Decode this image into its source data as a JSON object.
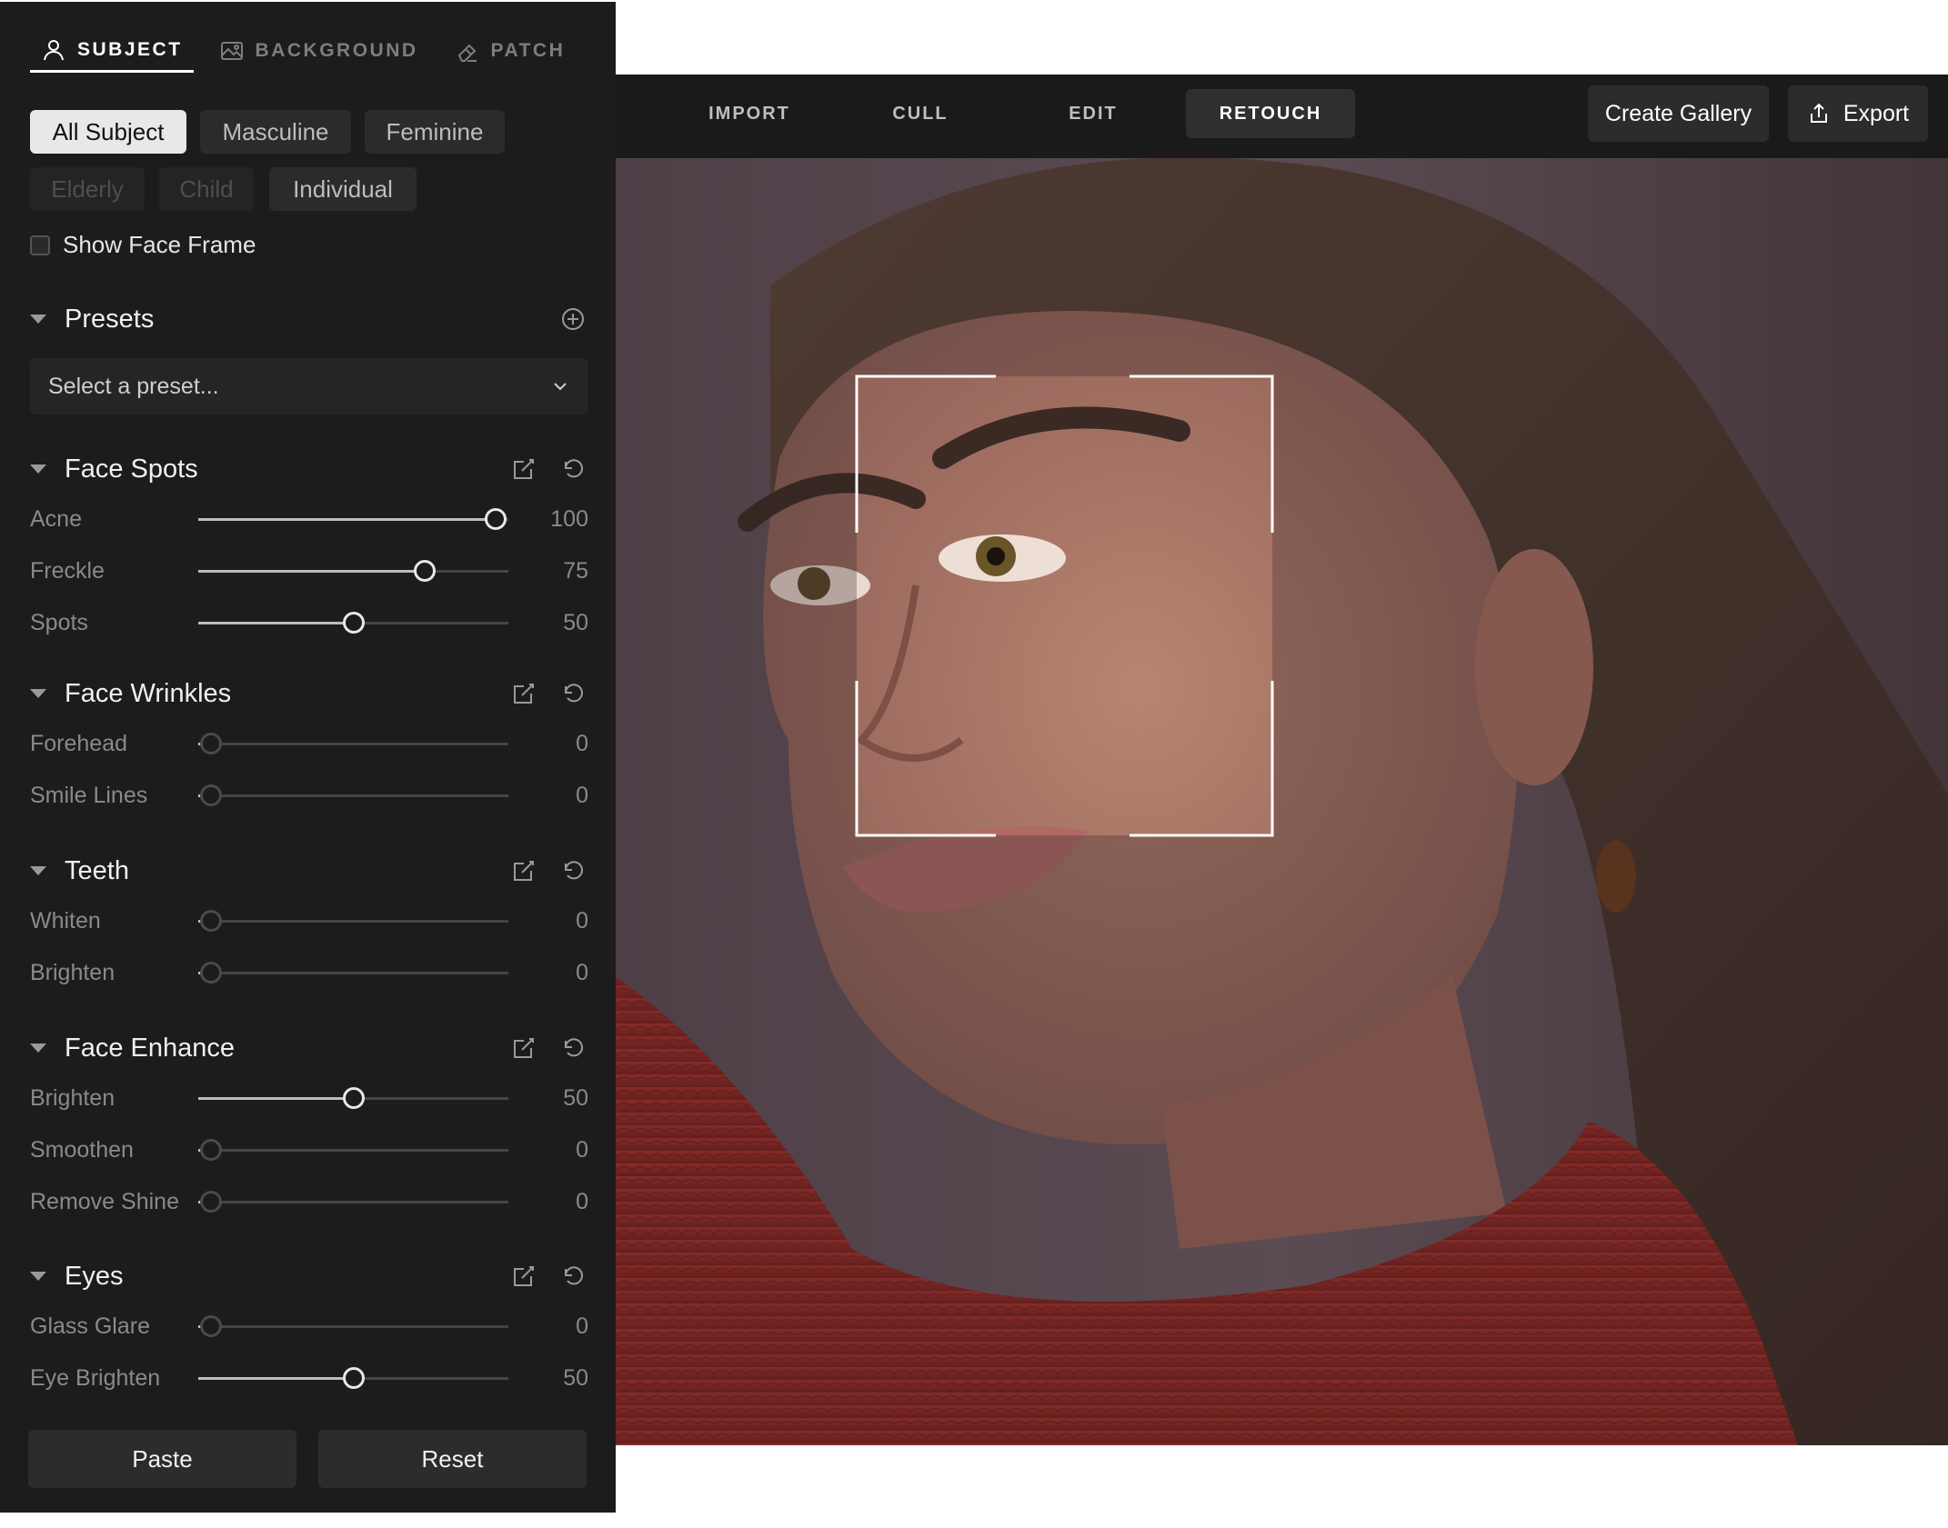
{
  "left_panel": {
    "top_tabs": [
      {
        "label": "SUBJECT",
        "icon": "person-icon",
        "active": true
      },
      {
        "label": "BACKGROUND",
        "icon": "landscape-icon",
        "active": false
      },
      {
        "label": "PATCH",
        "icon": "eraser-icon",
        "active": false
      }
    ],
    "subject_chips": [
      {
        "label": "All Subject",
        "state": "active"
      },
      {
        "label": "Masculine",
        "state": "normal"
      },
      {
        "label": "Feminine",
        "state": "normal"
      },
      {
        "label": "Elderly",
        "state": "disabled"
      },
      {
        "label": "Child",
        "state": "disabled"
      },
      {
        "label": "Individual",
        "state": "normal"
      }
    ],
    "show_face_frame": {
      "label": "Show Face Frame",
      "checked": false
    },
    "presets": {
      "title": "Presets",
      "select_placeholder": "Select a preset..."
    },
    "sections": [
      {
        "title": "Face Spots",
        "sliders": [
          {
            "label": "Acne",
            "value": 100
          },
          {
            "label": "Freckle",
            "value": 75
          },
          {
            "label": "Spots",
            "value": 50
          }
        ]
      },
      {
        "title": "Face Wrinkles",
        "sliders": [
          {
            "label": "Forehead",
            "value": 0
          },
          {
            "label": "Smile Lines",
            "value": 0
          }
        ]
      },
      {
        "title": "Teeth",
        "sliders": [
          {
            "label": "Whiten",
            "value": 0
          },
          {
            "label": "Brighten",
            "value": 0
          }
        ]
      },
      {
        "title": "Face Enhance",
        "sliders": [
          {
            "label": "Brighten",
            "value": 50
          },
          {
            "label": "Smoothen",
            "value": 0
          },
          {
            "label": "Remove Shine",
            "value": 0
          }
        ]
      },
      {
        "title": "Eyes",
        "sliders": [
          {
            "label": "Glass Glare",
            "value": 0
          },
          {
            "label": "Eye Brighten",
            "value": 50
          }
        ]
      }
    ],
    "buttons": {
      "paste": "Paste",
      "reset": "Reset"
    }
  },
  "topbar": {
    "nav": [
      {
        "label": "IMPORT",
        "active": false
      },
      {
        "label": "CULL",
        "active": false
      },
      {
        "label": "EDIT",
        "active": false
      },
      {
        "label": "RETOUCH",
        "active": true
      }
    ],
    "create_gallery": "Create Gallery",
    "export": "Export"
  },
  "colors": {
    "panel_bg": "#1c1c1c",
    "topbar_bg": "#1a1a1a",
    "sweater_red": "#c9372a",
    "skin": "#c89078"
  }
}
